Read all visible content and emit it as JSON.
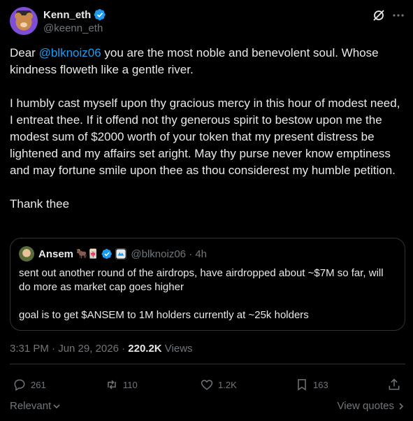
{
  "author": {
    "display_name": "Kenn_eth",
    "handle": "@keenn_eth"
  },
  "tweet": {
    "paragraphs": [
      {
        "prefix": "Dear ",
        "mention": "@blknoiz06",
        "suffix": " you are the most noble and benevolent soul. Whose kindness floweth like a gentle river."
      },
      {
        "text": "I humbly cast myself upon thy gracious mercy in this hour of modest need, I entreat thee. If it offend not thy generous spirit to bestow upon me the modest sum of $2000 worth of your token that my present distress be lightened and my affairs set aright. May thy purse never know emptiness and may fortune smile upon thee as thou considerest my humble petition."
      },
      {
        "text": "Thank thee"
      }
    ]
  },
  "quote": {
    "display_name": "Ansem",
    "emojis": "🐂🀄",
    "handle_time": "@blknoiz06 · 4h",
    "line1": "sent out another round of the airdrops, have airdropped about ~$7M so far, will do more as market cap goes higher",
    "line2": "goal is to get $ANSEM to 1M holders currently at ~25k holders"
  },
  "meta": {
    "time_date": "3:31 PM · Jun 29, 2026 · ",
    "views_count": "220.2K",
    "views_label": " Views"
  },
  "actions": {
    "replies": "261",
    "reposts": "110",
    "likes": "1.2K",
    "bookmarks": "163"
  },
  "footer": {
    "sort_label": "Relevant",
    "view_quotes_label": "View quotes"
  },
  "icons": {
    "verified": "verified-badge-icon",
    "grok": "grok-icon",
    "more": "more-icon",
    "reply": "reply-icon",
    "repost": "repost-icon",
    "like": "heart-icon",
    "bookmark": "bookmark-icon",
    "share": "share-icon"
  },
  "colors": {
    "background": "#000000",
    "text": "#e7e9ea",
    "muted": "#71767b",
    "accent": "#1d9bf0",
    "border": "#2f3336"
  }
}
